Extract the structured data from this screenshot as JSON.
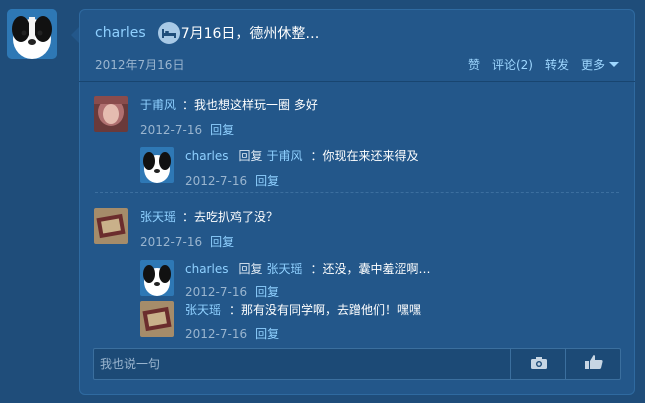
{
  "post": {
    "author": "charles",
    "title": "7月16日，德州休整…",
    "date": "2012年7月16日",
    "actions": {
      "like": "赞",
      "comments": "评论(2)",
      "forward": "转发",
      "more": "更多"
    }
  },
  "threads": [
    {
      "name": "于甫风",
      "text": "：我也想这样玩一圈 多好",
      "date": "2012-7-16",
      "reply_label": "回复",
      "replies": [
        {
          "name": "charles",
          "reply_word": "回复",
          "reply_to": "于甫风",
          "text": "：你现在来还来得及",
          "date": "2012-7-16",
          "reply_label": "回复"
        }
      ]
    },
    {
      "name": "张天瑶",
      "text": "：去吃扒鸡了没？",
      "date": "2012-7-16",
      "reply_label": "回复",
      "replies": [
        {
          "name": "charles",
          "reply_word": "回复",
          "reply_to": "张天瑶",
          "text": "：还没，囊中羞涩啊…",
          "date": "2012-7-16",
          "reply_label": "回复"
        },
        {
          "name": "张天瑶",
          "text": "：那有没有同学啊，去蹭他们！嘿嘿",
          "date": "2012-7-16",
          "reply_label": "回复"
        }
      ]
    }
  ],
  "composer": {
    "placeholder": "我也说一句",
    "camera_icon": "camera-icon",
    "like_icon": "thumbs-up-icon"
  }
}
